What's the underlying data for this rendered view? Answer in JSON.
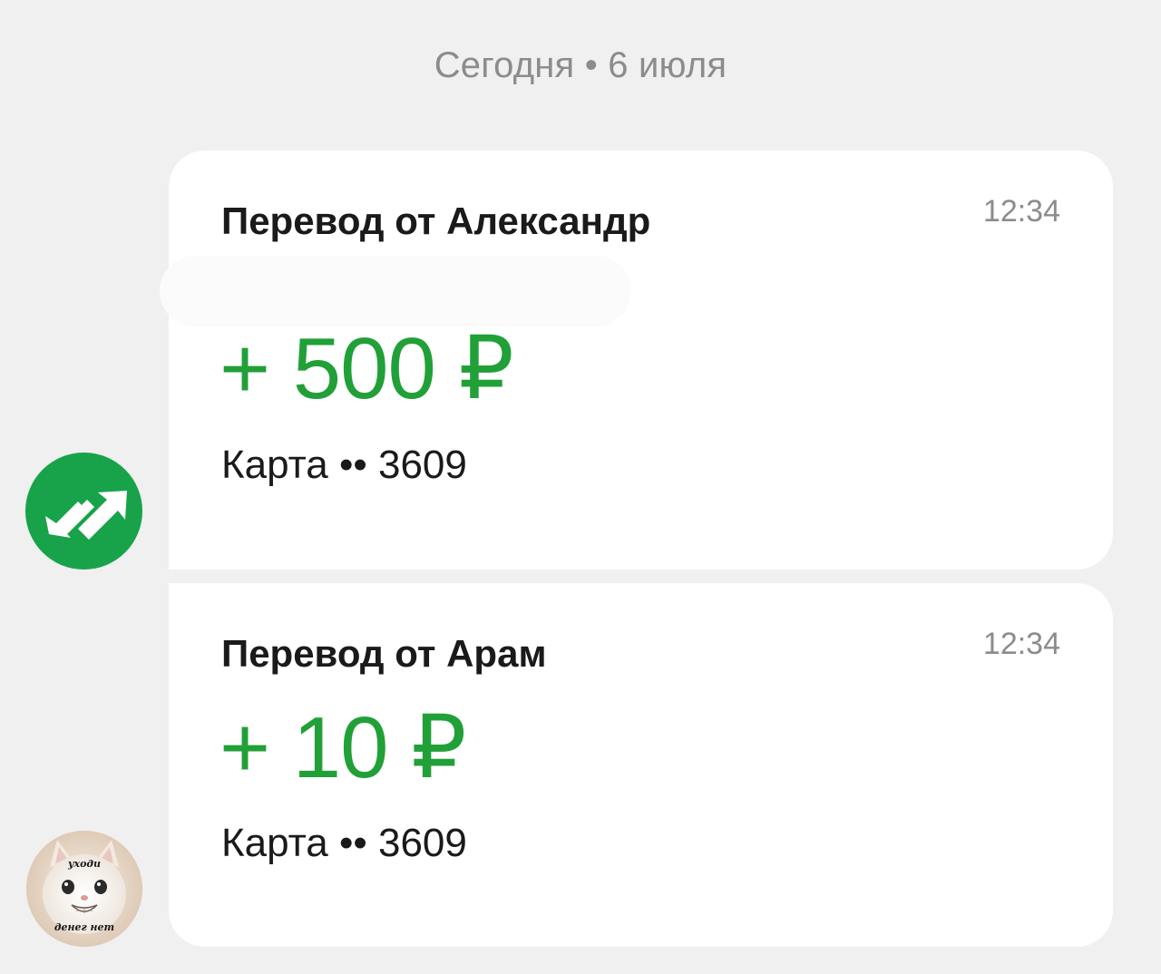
{
  "date_header": "Сегодня • 6 июля",
  "messages": [
    {
      "title": "Перевод от Александр",
      "time": "12:34",
      "amount": "+ 500 ₽",
      "card": "Карта •• 3609"
    },
    {
      "title": "Перевод от Арам",
      "time": "12:34",
      "amount": "+ 10 ₽",
      "card": "Карта •• 3609"
    }
  ],
  "avatars": {
    "transfer_icon": "transfer-arrows-icon",
    "sticker_top": "уходи",
    "sticker_bottom": "денег нет"
  },
  "colors": {
    "accent_green": "#21a038",
    "avatar_green": "#18a34a",
    "background": "#f0f0f0",
    "bubble": "#ffffff"
  }
}
